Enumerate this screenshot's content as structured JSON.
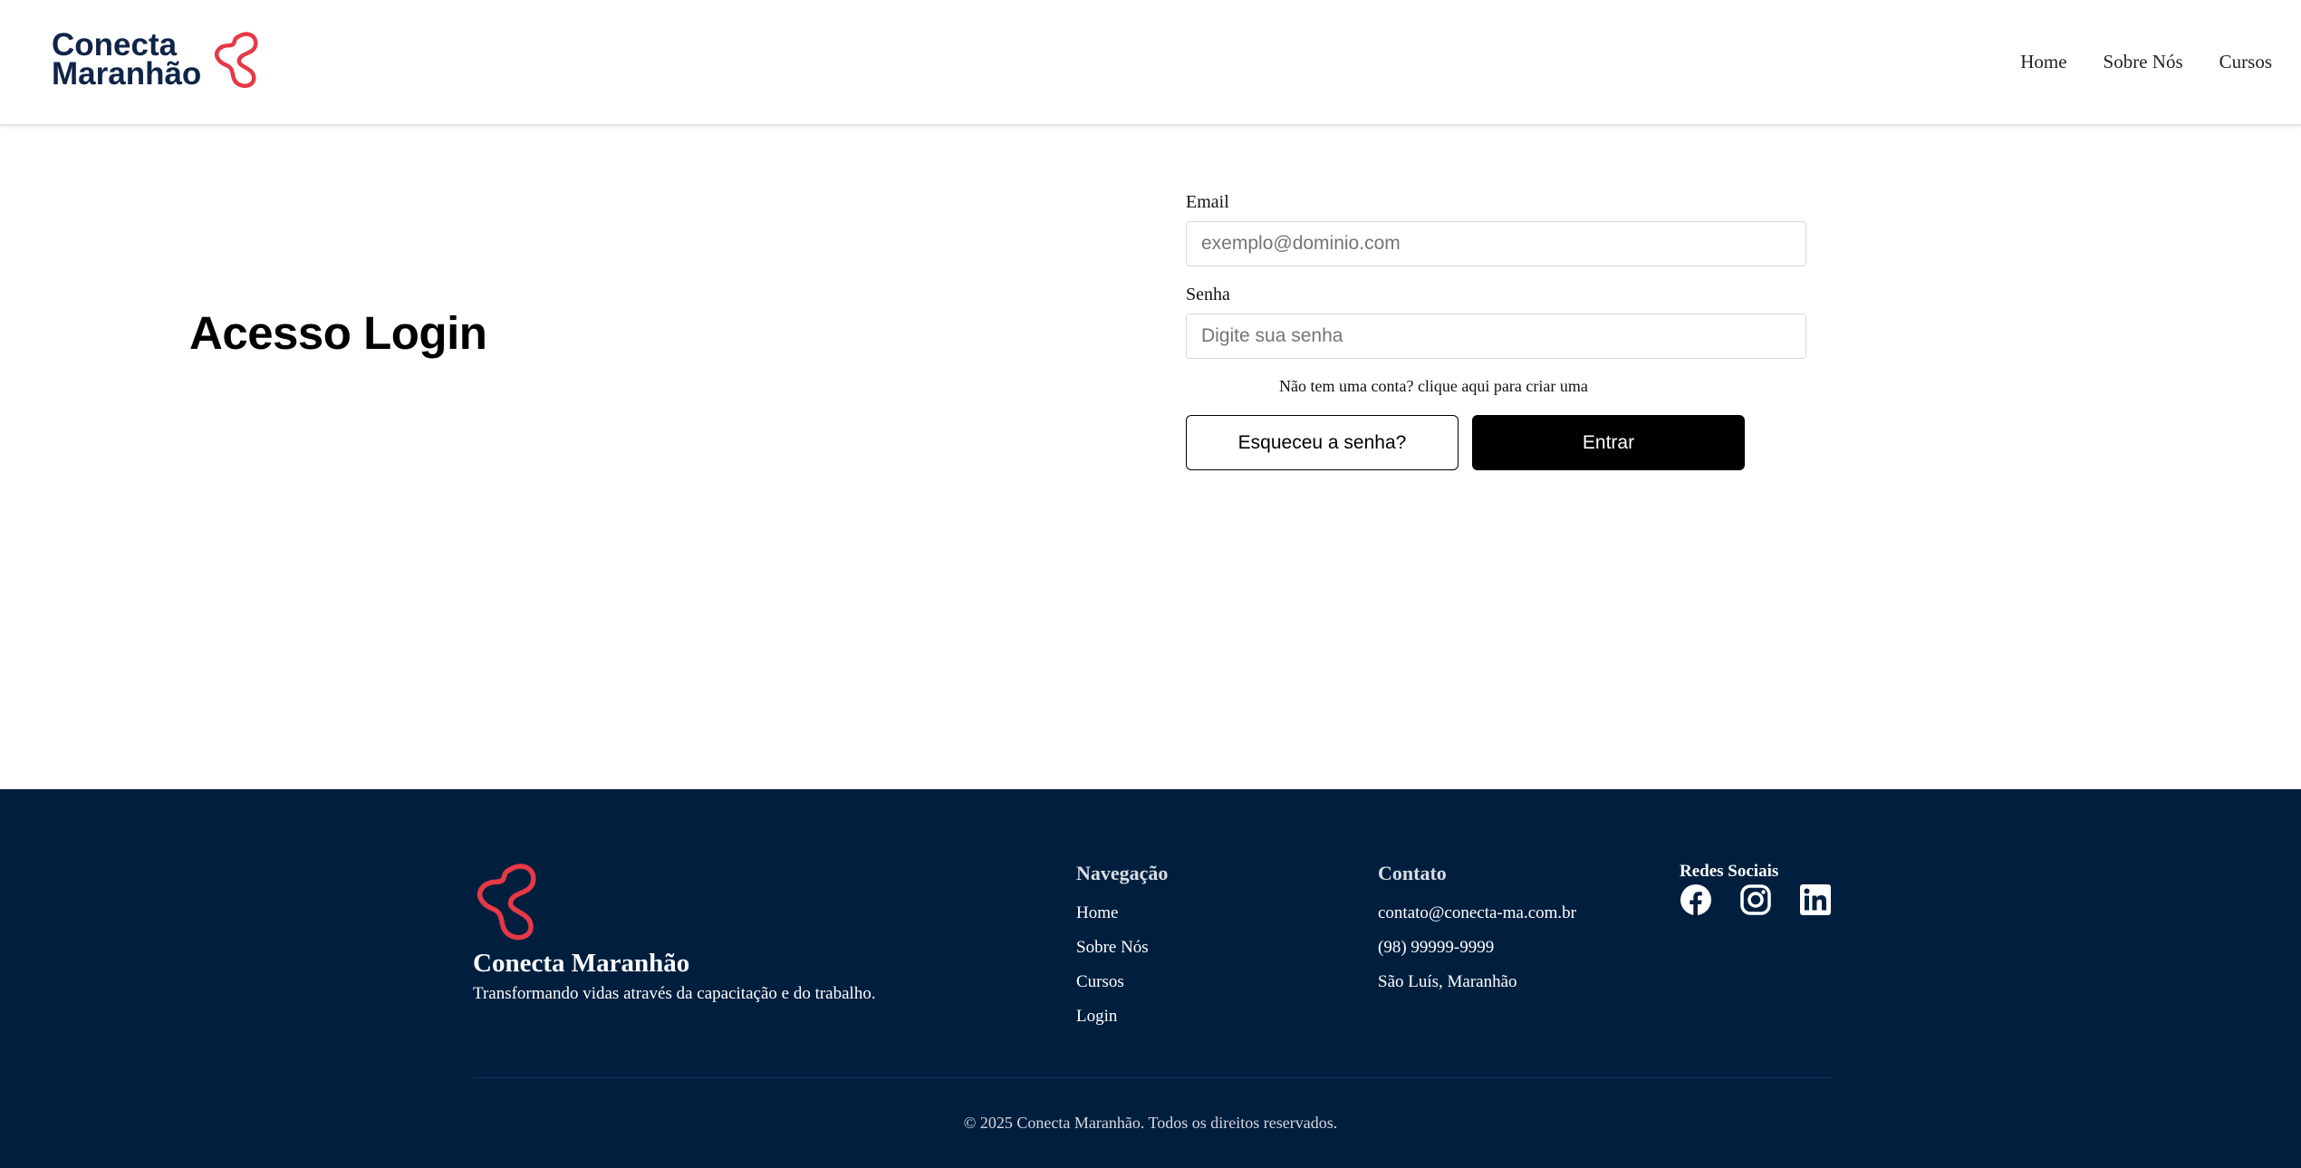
{
  "header": {
    "logo_line1": "Conecta",
    "logo_line2": "Maranhão",
    "nav": [
      "Home",
      "Sobre Nós",
      "Cursos"
    ]
  },
  "main": {
    "title": "Acesso Login",
    "email_label": "Email",
    "email_placeholder": "exemplo@dominio.com",
    "password_label": "Senha",
    "password_placeholder": "Digite sua senha",
    "signup_link": "Não tem uma conta? clique aqui para criar uma",
    "forgot_button": "Esqueceu a senha?",
    "submit_button": "Entrar"
  },
  "footer": {
    "brand_name": "Conecta Maranhão",
    "tagline": "Transformando vidas através da capacitação e do trabalho.",
    "nav_title": "Navegação",
    "nav_items": [
      "Home",
      "Sobre Nós",
      "Cursos",
      "Login"
    ],
    "contact_title": "Contato",
    "contact_items": [
      "contato@conecta-ma.com.br",
      "(98) 99999-9999",
      "São Luís, Maranhão"
    ],
    "social_title": "Redes Sociais",
    "social_icons": [
      "facebook-icon",
      "instagram-icon",
      "linkedin-icon"
    ],
    "copyright": "© 2025 Conecta Maranhão. Todos os direitos reservados."
  },
  "colors": {
    "brand_navy": "#0f2448",
    "brand_red": "#e63946",
    "footer_bg": "#001f3f",
    "button_dark": "#000000"
  }
}
